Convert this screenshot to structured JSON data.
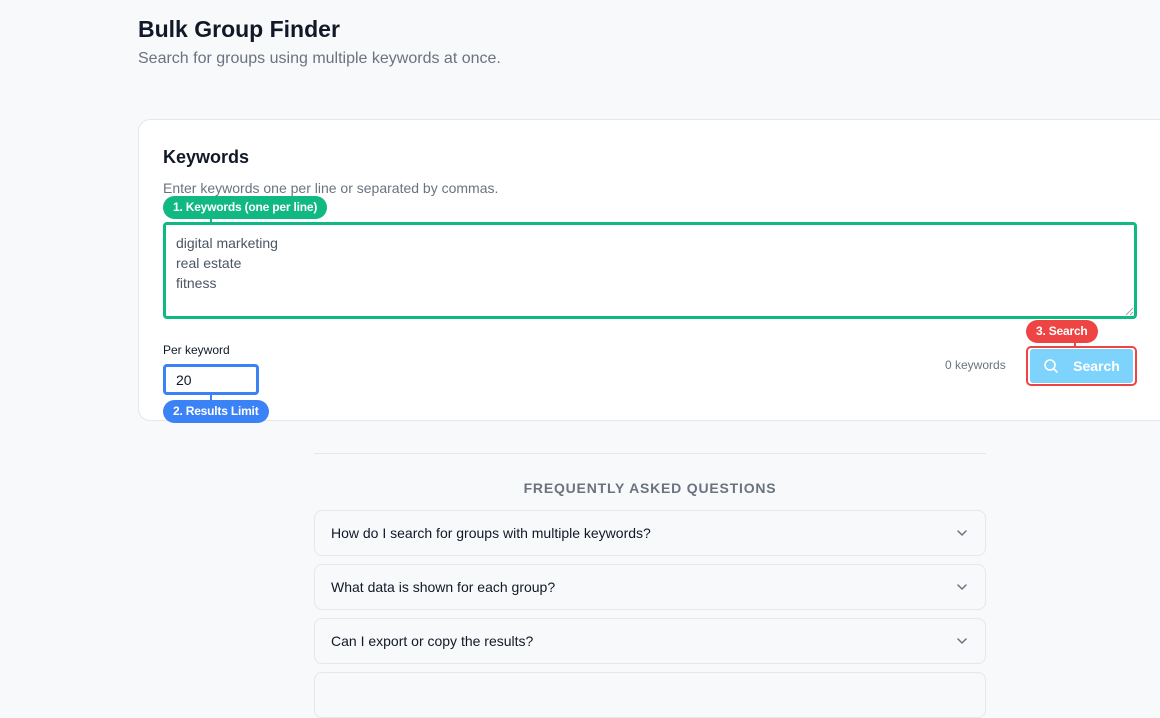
{
  "header": {
    "title": "Bulk Group Finder",
    "subtitle": "Search for groups using multiple keywords at once."
  },
  "keywords_card": {
    "title": "Keywords",
    "hint": "Enter keywords one per line or separated by commas.",
    "textarea_value": "digital marketing\nreal estate\nfitness",
    "per_keyword_label": "Per keyword",
    "per_keyword_value": "20",
    "keyword_count": "0 keywords",
    "search_label": "Search"
  },
  "annotations": {
    "keywords_badge": "1. Keywords (one per line)",
    "results_limit_badge": "2. Results Limit",
    "search_badge": "3. Search"
  },
  "faq": {
    "heading": "FREQUENTLY ASKED QUESTIONS",
    "items": [
      {
        "question": "How do I search for groups with multiple keywords?"
      },
      {
        "question": "What data is shown for each group?"
      },
      {
        "question": "Can I export or copy the results?"
      }
    ]
  },
  "colors": {
    "annotation_green": "#10b981",
    "annotation_blue": "#3b82f6",
    "annotation_red": "#ef4444",
    "search_button": "#7dd3fc"
  }
}
